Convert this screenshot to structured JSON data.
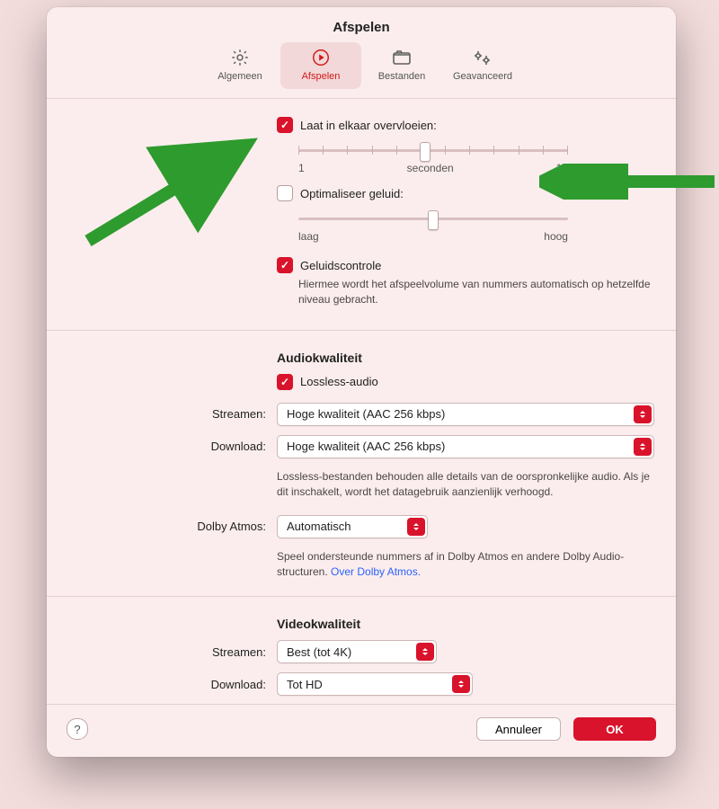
{
  "window": {
    "title": "Afspelen"
  },
  "tabs": {
    "general": "Algemeen",
    "playback": "Afspelen",
    "files": "Bestanden",
    "advanced": "Geavanceerd"
  },
  "crossfade": {
    "label": "Laat in elkaar overvloeien:",
    "min": "1",
    "unit": "seconden",
    "max": "12"
  },
  "enhancer": {
    "label": "Optimaliseer geluid:",
    "low": "laag",
    "high": "hoog"
  },
  "soundcheck": {
    "label": "Geluidscontrole",
    "desc": "Hiermee wordt het afspeelvolume van nummers automatisch op hetzelfde niveau gebracht."
  },
  "audio": {
    "heading": "Audiokwaliteit",
    "lossless_label": "Lossless-audio",
    "stream_label": "Streamen:",
    "stream_value": "Hoge kwaliteit (AAC 256 kbps)",
    "download_label": "Download:",
    "download_value": "Hoge kwaliteit (AAC 256 kbps)",
    "note": "Lossless-bestanden behouden alle details van de oorspronkelijke audio. Als je dit inschakelt, wordt het datagebruik aanzienlijk verhoogd.",
    "dolby_label": "Dolby Atmos:",
    "dolby_value": "Automatisch",
    "dolby_note_pre": "Speel ondersteunde nummers af in Dolby Atmos en andere Dolby Audio-structuren. ",
    "dolby_link": "Over Dolby Atmos."
  },
  "video": {
    "heading": "Videokwaliteit",
    "stream_label": "Streamen:",
    "stream_value": "Best (tot 4K)",
    "download_label": "Download:",
    "download_value": "Tot HD"
  },
  "footer": {
    "cancel": "Annuleer",
    "ok": "OK"
  }
}
